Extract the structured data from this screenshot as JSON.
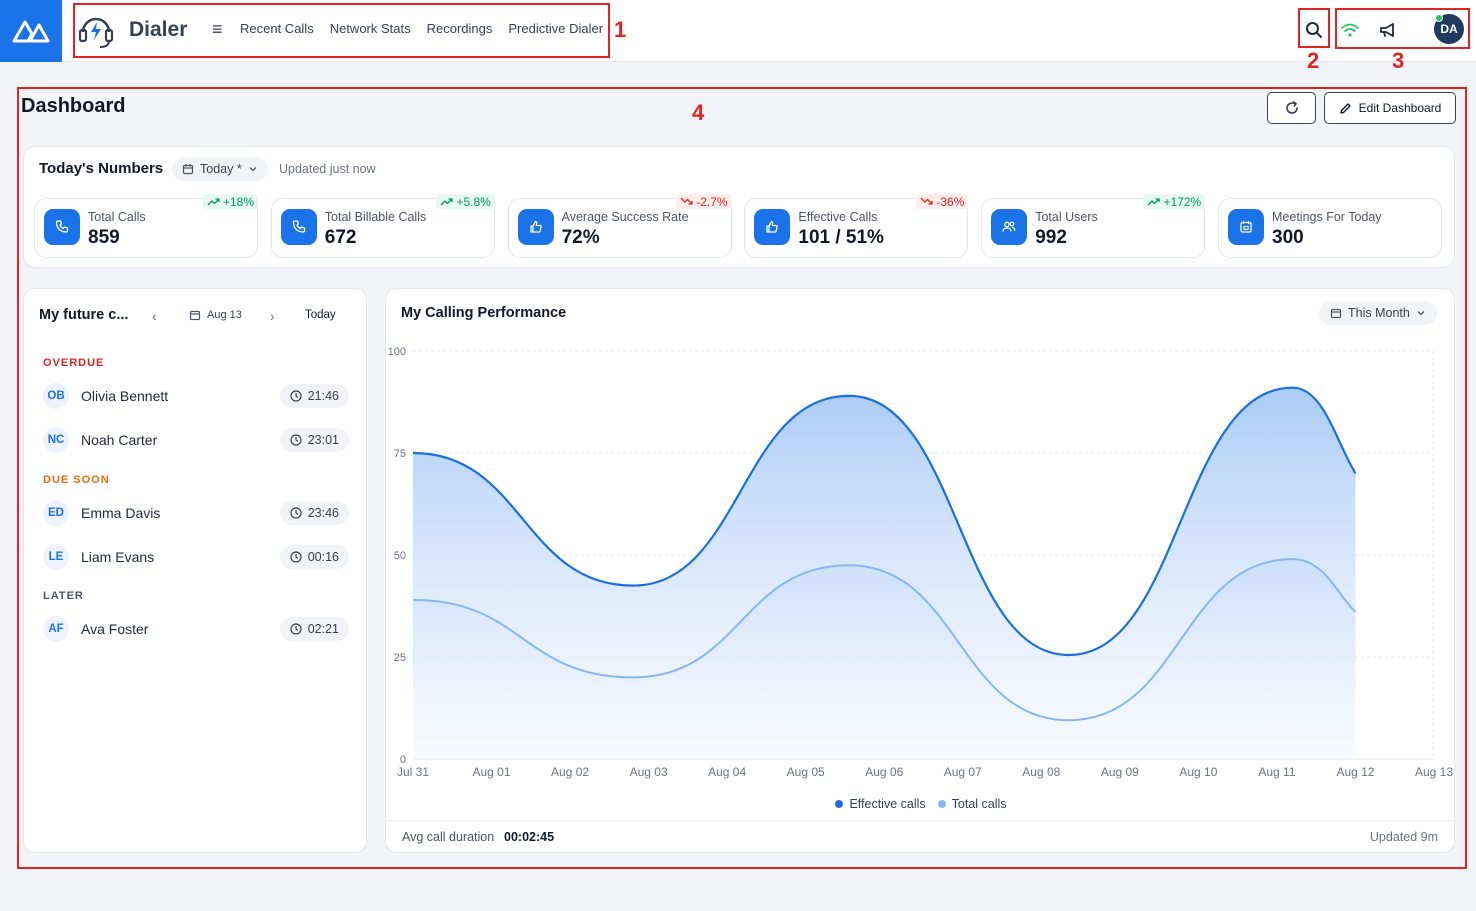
{
  "header": {
    "brand_name": "Dialer",
    "nav": [
      "Recent Calls",
      "Network Stats",
      "Recordings",
      "Predictive Dialer"
    ],
    "avatar_initials": "DA"
  },
  "annotations": [
    "1",
    "2",
    "3",
    "4"
  ],
  "dashboard": {
    "title": "Dashboard",
    "edit_label": "Edit Dashboard"
  },
  "numbers": {
    "title": "Today's Numbers",
    "period": "Today *",
    "updated": "Updated just now",
    "stats": [
      {
        "label": "Total Calls",
        "value": "859",
        "trend": "+18%",
        "direction": "up",
        "icon": "phone-icon"
      },
      {
        "label": "Total Billable Calls",
        "value": "672",
        "trend": "+5.8%",
        "direction": "up",
        "icon": "phone-icon"
      },
      {
        "label": "Average Success Rate",
        "value": "72%",
        "trend": "-2.7%",
        "direction": "down",
        "icon": "thumbs-up-icon"
      },
      {
        "label": "Effective Calls",
        "value": "101 / 51%",
        "trend": "-36%",
        "direction": "down",
        "icon": "thumbs-up-icon"
      },
      {
        "label": "Total Users",
        "value": "992",
        "trend": "+172%",
        "direction": "up",
        "icon": "users-icon"
      },
      {
        "label": "Meetings For Today",
        "value": "300",
        "trend": "",
        "direction": "",
        "icon": "calendar-icon"
      }
    ]
  },
  "future_calls": {
    "title": "My future c...",
    "date": "Aug 13",
    "today_label": "Today",
    "sections": [
      {
        "label": "OVERDUE",
        "color": "#e02424",
        "items": [
          {
            "initials": "OB",
            "name": "Olivia Bennett",
            "time": "21:46"
          },
          {
            "initials": "NC",
            "name": "Noah Carter",
            "time": "23:01"
          }
        ]
      },
      {
        "label": "DUE SOON",
        "color": "#ea6a12",
        "items": [
          {
            "initials": "ED",
            "name": "Emma Davis",
            "time": "23:46"
          },
          {
            "initials": "LE",
            "name": "Liam Evans",
            "time": "00:16"
          }
        ]
      },
      {
        "label": "LATER",
        "color": "#4b5563",
        "items": [
          {
            "initials": "AF",
            "name": "Ava Foster",
            "time": "02:21"
          }
        ]
      }
    ]
  },
  "performance": {
    "title": "My Calling Performance",
    "period": "This Month",
    "avg_label": "Avg call duration",
    "avg_value": "00:02:45",
    "updated": "Updated 9m"
  },
  "chart_data": {
    "type": "area",
    "x": [
      "Jul 31",
      "Aug 01",
      "Aug 02",
      "Aug 03",
      "Aug 04",
      "Aug 05",
      "Aug 06",
      "Aug 07",
      "Aug 08",
      "Aug 09",
      "Aug 10",
      "Aug 11",
      "Aug 12",
      "Aug 13"
    ],
    "y_ticks": [
      "0",
      "25",
      "50",
      "75",
      "100"
    ],
    "ylim": [
      0,
      100
    ],
    "series": [
      {
        "name": "Effective calls",
        "color": "#1a6fe0",
        "points": [
          [
            0,
            75
          ],
          [
            2.8,
            42.5
          ],
          [
            5.55,
            89
          ],
          [
            8.35,
            25.5
          ],
          [
            11.2,
            91
          ],
          [
            12,
            70
          ]
        ]
      },
      {
        "name": "Total calls",
        "color": "#8ab6f2",
        "points": [
          [
            0,
            39
          ],
          [
            2.8,
            20
          ],
          [
            5.55,
            47.5
          ],
          [
            8.35,
            9.5
          ],
          [
            11.2,
            49
          ],
          [
            12,
            36
          ]
        ]
      }
    ],
    "grid": "dashed"
  }
}
